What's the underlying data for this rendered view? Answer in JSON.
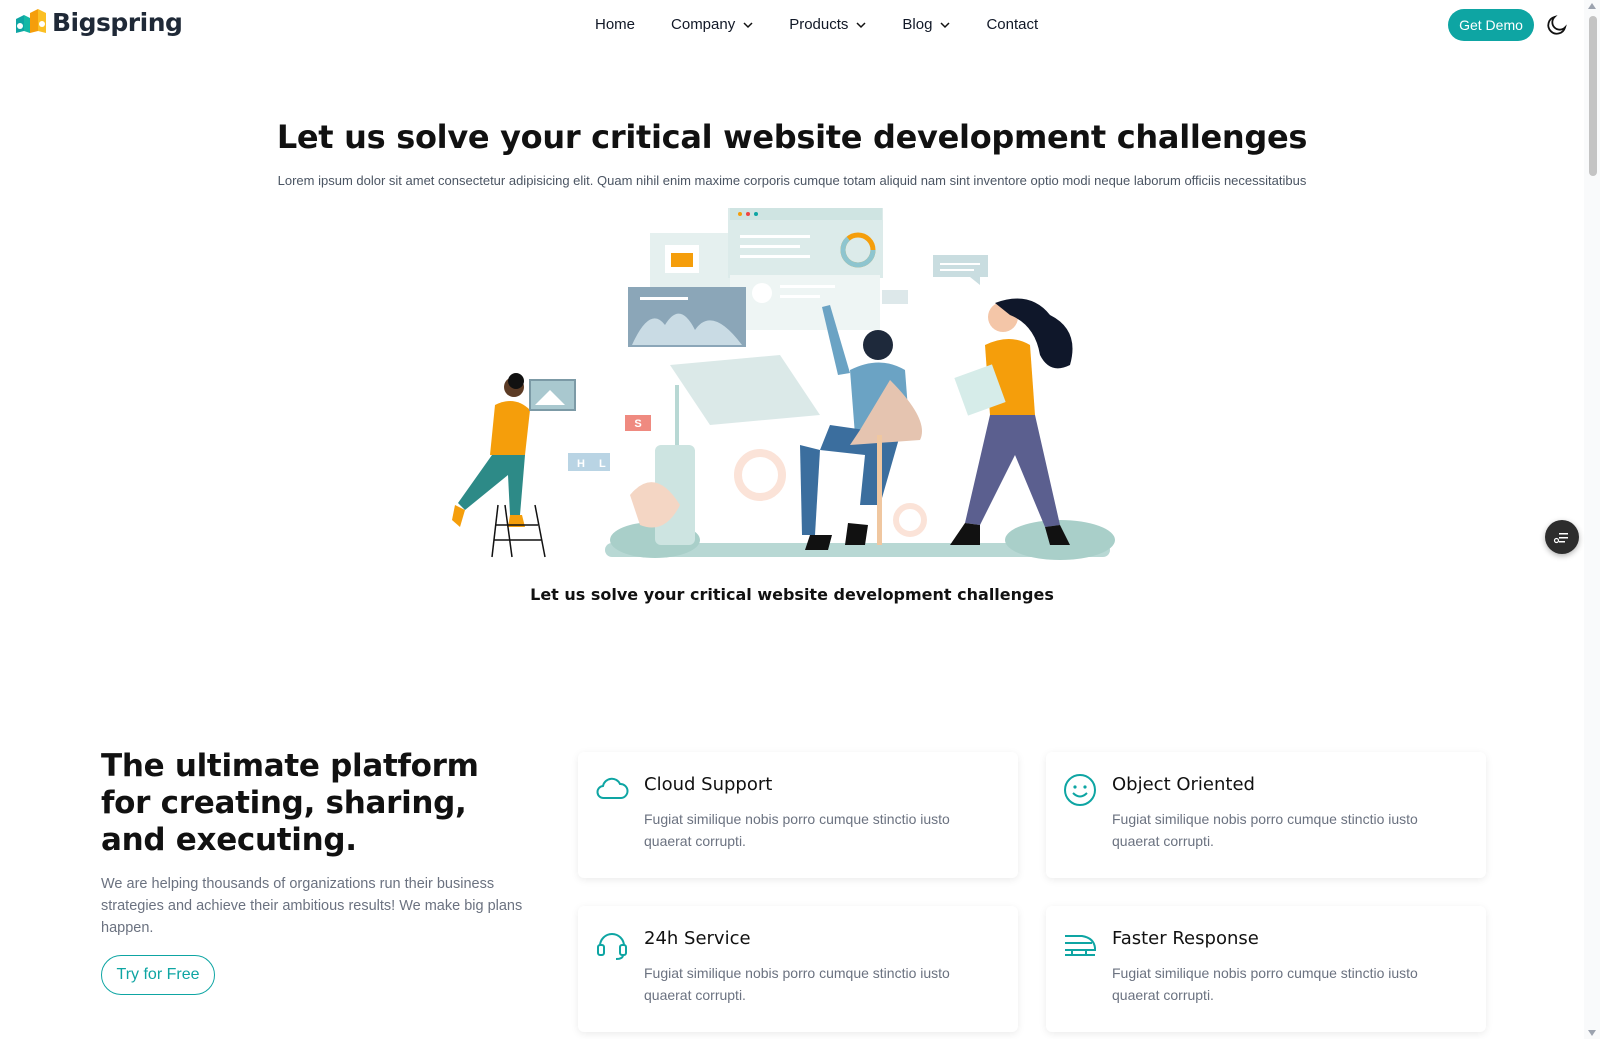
{
  "header": {
    "logo_text": "Bigspring",
    "nav": [
      {
        "label": "Home",
        "has_dropdown": false
      },
      {
        "label": "Company",
        "has_dropdown": true
      },
      {
        "label": "Products",
        "has_dropdown": true
      },
      {
        "label": "Blog",
        "has_dropdown": true
      },
      {
        "label": "Contact",
        "has_dropdown": false
      }
    ],
    "cta_label": "Get Demo",
    "theme_icon": "moon-icon"
  },
  "hero": {
    "title": "Let us solve your critical website development challenges",
    "subtitle": "Lorem ipsum dolor sit amet consectetur adipisicing elit. Quam nihil enim maxime corporis cumque totam aliquid nam sint inventore optio modi neque laborum officiis necessitatibus",
    "caption": "Let us solve your critical website development challenges",
    "illustration_letters": {
      "s": "S",
      "h": "H",
      "l": "L"
    }
  },
  "platform": {
    "title": "The ultimate platform for creating, sharing, and executing.",
    "description": "We are helping thousands of organizations run their business strategies and achieve their ambitious results! We make big plans happen.",
    "cta_label": "Try for Free"
  },
  "features": [
    {
      "icon": "cloud-icon",
      "title": "Cloud Support",
      "description": "Fugiat similique nobis porro cumque stinctio iusto quaerat corrupti."
    },
    {
      "icon": "smile-icon",
      "title": "Object Oriented",
      "description": "Fugiat similique nobis porro cumque stinctio iusto quaerat corrupti."
    },
    {
      "icon": "headset-icon",
      "title": "24h Service",
      "description": "Fugiat similique nobis porro cumque stinctio iusto quaerat corrupti."
    },
    {
      "icon": "train-icon",
      "title": "Faster Response",
      "description": "Fugiat similique nobis porro cumque stinctio iusto quaerat corrupti."
    }
  ],
  "colors": {
    "accent": "#0ea5a3",
    "text": "#111827",
    "muted": "#6b7280"
  }
}
